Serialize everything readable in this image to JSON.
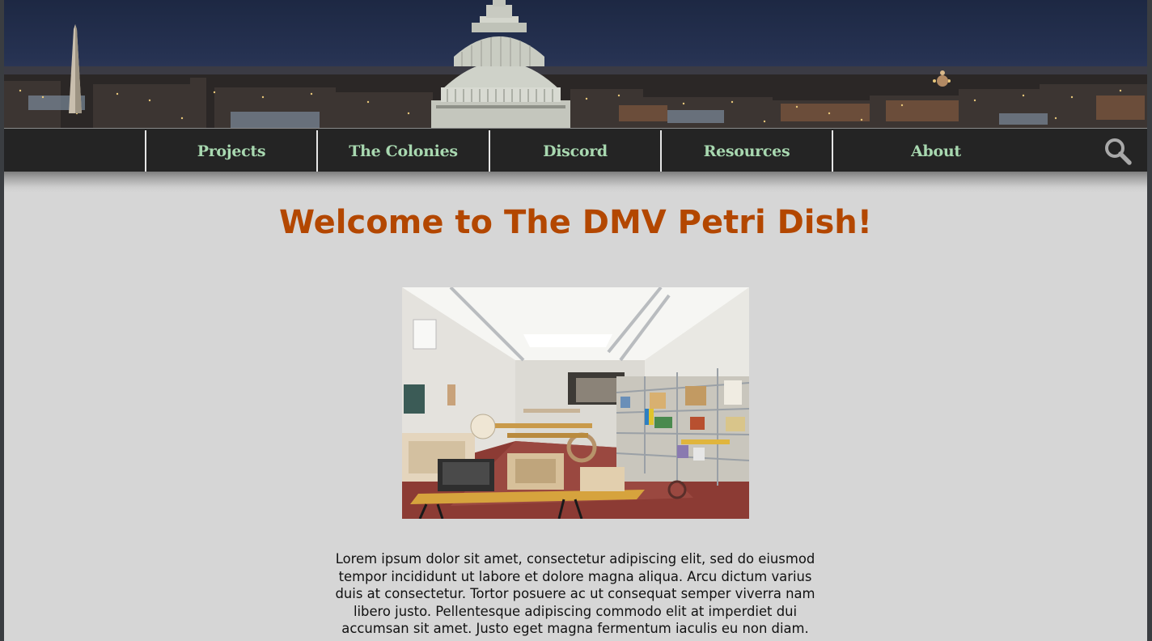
{
  "nav": {
    "items": [
      {
        "label": "Projects"
      },
      {
        "label": "The Colonies"
      },
      {
        "label": "Discord"
      },
      {
        "label": "Resources"
      },
      {
        "label": "About"
      }
    ],
    "search_icon": "search-icon"
  },
  "banner": {
    "icon": "city-skyline-image"
  },
  "main": {
    "title": "Welcome to The DMV Petri Dish!",
    "hero_image": "makerspace-workshop-photo",
    "paragraph": "Lorem ipsum dolor sit amet, consectetur adipiscing elit, sed do eiusmod tempor incididunt ut labore et dolore magna aliqua. Arcu dictum varius duis at consectetur. Tortor posuere ac ut consequat semper viverra nam libero justo. Pellentesque adipiscing commodo elit at imperdiet dui accumsan sit amet. Justo eget magna fermentum iaculis eu non diam."
  },
  "colors": {
    "title": "#b34700",
    "nav_text": "#a8d8b0",
    "nav_bg": "#242424",
    "page_bg": "#d6d6d6"
  }
}
